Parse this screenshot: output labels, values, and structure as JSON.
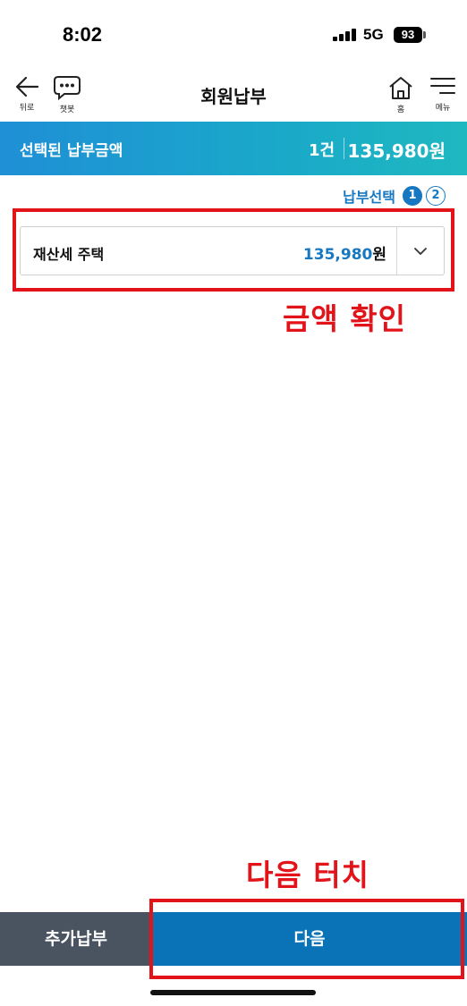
{
  "status_bar": {
    "time": "8:02",
    "network": "5G",
    "battery": "93"
  },
  "header": {
    "title": "회원납부",
    "back_label": "뒤로",
    "chatbot_label": "챗봇",
    "home_label": "홈",
    "menu_label": "메뉴"
  },
  "summary": {
    "label": "선택된 납부금액",
    "count": "1건",
    "amount": "135,980원"
  },
  "steps": {
    "label": "납부선택",
    "items": [
      "1",
      "2"
    ],
    "active": 1
  },
  "tax_item": {
    "name": "재산세 주택",
    "amount": "135,980",
    "unit": "원"
  },
  "annotations": {
    "amount_check": "금액 확인",
    "touch_next": "다음 터치",
    "color": "#e3131a"
  },
  "bottom": {
    "add_label": "추가납부",
    "next_label": "다음"
  },
  "colors": {
    "accent": "#1777c0",
    "next_button": "#0a73b7",
    "add_button": "#4a5461"
  },
  "icons": [
    "back-arrow-icon",
    "chatbot-icon",
    "home-icon",
    "menu-icon",
    "chevron-down-icon"
  ]
}
